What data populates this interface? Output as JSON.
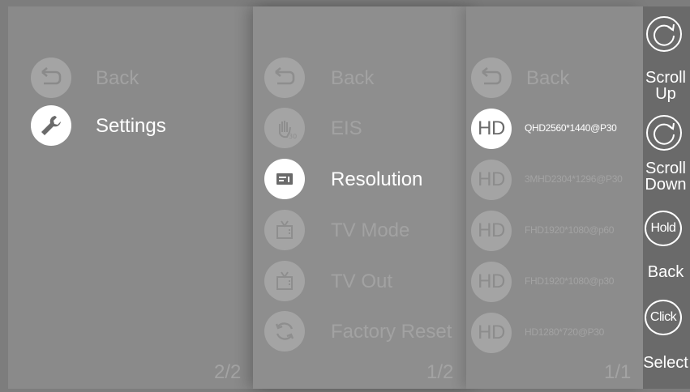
{
  "panel1": {
    "items": [
      {
        "label": "Back",
        "icon": "back-arrow-icon",
        "active": false
      },
      {
        "label": "Settings",
        "icon": "wrench-icon",
        "active": true
      }
    ],
    "page": "2/2"
  },
  "panel2": {
    "items": [
      {
        "label": "Back",
        "icon": "back-arrow-icon",
        "active": false
      },
      {
        "label": "EIS",
        "icon": "shaking-hand-icon",
        "active": false
      },
      {
        "label": "Resolution",
        "icon": "resolution-icon",
        "active": true
      },
      {
        "label": "TV Mode",
        "icon": "tv-icon",
        "active": false
      },
      {
        "label": "TV Out",
        "icon": "tv-icon",
        "active": false
      },
      {
        "label": "Factory Reset",
        "icon": "refresh-icon",
        "active": false
      }
    ],
    "page": "1/2"
  },
  "panel3": {
    "items": [
      {
        "label": "Back",
        "icon": "back-arrow-icon",
        "active": false
      },
      {
        "label": "QHD2560*1440@P30",
        "badge": "HD",
        "active": true
      },
      {
        "label": "3MHD2304*1296@P30",
        "badge": "HD",
        "active": false
      },
      {
        "label": "FHD1920*1080@p60",
        "badge": "HD",
        "active": false
      },
      {
        "label": "FHD1920*1080@p30",
        "badge": "HD",
        "active": false
      },
      {
        "label": "HD1280*720@P30",
        "badge": "HD",
        "active": false
      }
    ],
    "page": "1/1"
  },
  "sidebar": {
    "scroll_up": "Scroll Up",
    "scroll_up_l1": "Scroll",
    "scroll_up_l2": "Up",
    "scroll_down_l1": "Scroll",
    "scroll_down_l2": "Down",
    "hold_badge": "Hold",
    "hold_label": "Back",
    "click_badge": "Click",
    "click_label": "Select"
  },
  "colors": {
    "background": "#7d7d7d",
    "active_text": "#ffffff",
    "inactive_text": "#a2a2a2",
    "sidebar": "#6a6a6a"
  }
}
